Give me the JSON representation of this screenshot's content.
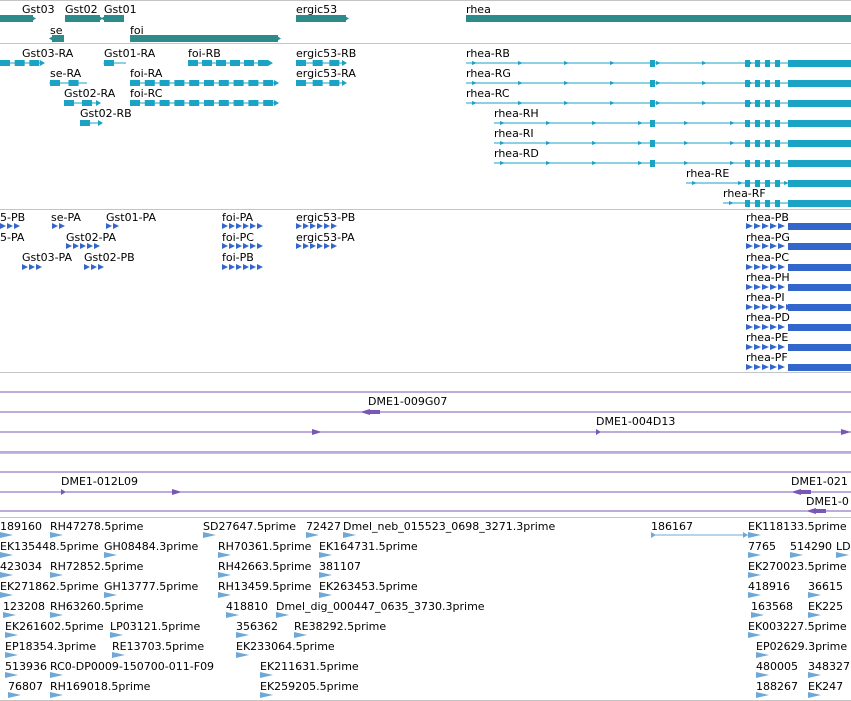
{
  "colors": {
    "gene": "#2e8b8b",
    "transcript": "#1aa3c4",
    "protein": "#3366cc",
    "clone": "#7b57b5",
    "est": "#6fa8d6",
    "separator": "#c4c4c4"
  },
  "tracks": [
    {
      "id": "gene-track",
      "features": [
        {
          "label": "Gst03",
          "kind": "gene",
          "strand": "+"
        },
        {
          "label": "Gst02",
          "kind": "gene",
          "strand": "+"
        },
        {
          "label": "Gst01",
          "kind": "gene",
          "strand": "-"
        },
        {
          "label": "se",
          "kind": "gene",
          "strand": "-"
        },
        {
          "label": "foi",
          "kind": "gene",
          "strand": "+"
        },
        {
          "label": "ergic53",
          "kind": "gene",
          "strand": "+"
        },
        {
          "label": "rhea",
          "kind": "gene",
          "strand": "+"
        }
      ]
    },
    {
      "id": "transcript-track",
      "features": [
        {
          "label": "Gst03-RA",
          "kind": "transcript",
          "strand": "+"
        },
        {
          "label": "Gst01-RA",
          "kind": "transcript",
          "strand": "-"
        },
        {
          "label": "foi-RB",
          "kind": "transcript",
          "strand": "+"
        },
        {
          "label": "ergic53-RB",
          "kind": "transcript",
          "strand": "+"
        },
        {
          "label": "rhea-RB",
          "kind": "transcript",
          "strand": "+"
        },
        {
          "label": "se-RA",
          "kind": "transcript",
          "strand": "-"
        },
        {
          "label": "foi-RA",
          "kind": "transcript",
          "strand": "+"
        },
        {
          "label": "ergic53-RA",
          "kind": "transcript",
          "strand": "+"
        },
        {
          "label": "rhea-RG",
          "kind": "transcript",
          "strand": "+"
        },
        {
          "label": "Gst02-RA",
          "kind": "transcript",
          "strand": "+"
        },
        {
          "label": "foi-RC",
          "kind": "transcript",
          "strand": "+"
        },
        {
          "label": "rhea-RC",
          "kind": "transcript",
          "strand": "+"
        },
        {
          "label": "Gst02-RB",
          "kind": "transcript",
          "strand": "+"
        },
        {
          "label": "rhea-RH",
          "kind": "transcript",
          "strand": "+"
        },
        {
          "label": "rhea-RI",
          "kind": "transcript",
          "strand": "+"
        },
        {
          "label": "rhea-RD",
          "kind": "transcript",
          "strand": "+"
        },
        {
          "label": "rhea-RE",
          "kind": "transcript",
          "strand": "+"
        },
        {
          "label": "rhea-RF",
          "kind": "transcript",
          "strand": "+"
        }
      ]
    },
    {
      "id": "protein-track",
      "features": [
        {
          "label": "5-PB",
          "kind": "protein",
          "strand": "+"
        },
        {
          "label": "se-PA",
          "kind": "protein",
          "strand": "-"
        },
        {
          "label": "Gst01-PA",
          "kind": "protein",
          "strand": "-"
        },
        {
          "label": "foi-PA",
          "kind": "protein",
          "strand": "+"
        },
        {
          "label": "ergic53-PB",
          "kind": "protein",
          "strand": "+"
        },
        {
          "label": "rhea-PB",
          "kind": "protein",
          "strand": "+"
        },
        {
          "label": "5-PA",
          "kind": "protein",
          "strand": "+"
        },
        {
          "label": "Gst02-PA",
          "kind": "protein",
          "strand": "+"
        },
        {
          "label": "foi-PC",
          "kind": "protein",
          "strand": "+"
        },
        {
          "label": "ergic53-PA",
          "kind": "protein",
          "strand": "+"
        },
        {
          "label": "rhea-PG",
          "kind": "protein",
          "strand": "+"
        },
        {
          "label": "Gst03-PA",
          "kind": "protein",
          "strand": "+"
        },
        {
          "label": "Gst02-PB",
          "kind": "protein",
          "strand": "+"
        },
        {
          "label": "foi-PB",
          "kind": "protein",
          "strand": "+"
        },
        {
          "label": "rhea-PC",
          "kind": "protein",
          "strand": "+"
        },
        {
          "label": "rhea-PH",
          "kind": "protein",
          "strand": "+"
        },
        {
          "label": "rhea-PI",
          "kind": "protein",
          "strand": "+"
        },
        {
          "label": "rhea-PD",
          "kind": "protein",
          "strand": "+"
        },
        {
          "label": "rhea-PE",
          "kind": "protein",
          "strand": "+"
        },
        {
          "label": "rhea-PF",
          "kind": "protein",
          "strand": "+"
        }
      ]
    },
    {
      "id": "clone-track-1",
      "features": [
        {
          "label": "DME1-009G07",
          "kind": "clone",
          "strand": "-"
        },
        {
          "label": "DME1-004D13",
          "kind": "clone",
          "strand": "+"
        }
      ]
    },
    {
      "id": "clone-track-2",
      "features": [
        {
          "label": "DME1-012L09",
          "kind": "clone",
          "strand": "+"
        },
        {
          "label": "DME1-021",
          "kind": "clone",
          "strand": "-"
        },
        {
          "label": "DME1-0",
          "kind": "clone",
          "strand": "-"
        }
      ]
    },
    {
      "id": "est-track",
      "features": [
        {
          "label": "189160",
          "kind": "est"
        },
        {
          "label": "RH47278.5prime",
          "kind": "est"
        },
        {
          "label": "SD27647.5prime",
          "kind": "est"
        },
        {
          "label": "72427",
          "kind": "est"
        },
        {
          "label": "Dmel_neb_015523_0698_3271.3prime",
          "kind": "est"
        },
        {
          "label": "186167",
          "kind": "est"
        },
        {
          "label": "EK118133.5prime",
          "kind": "est"
        },
        {
          "label": "EK135448.5prime",
          "kind": "est"
        },
        {
          "label": "GH08484.3prime",
          "kind": "est"
        },
        {
          "label": "RH70361.5prime",
          "kind": "est"
        },
        {
          "label": "EK164731.5prime",
          "kind": "est"
        },
        {
          "label": "7765",
          "kind": "est"
        },
        {
          "label": "514290",
          "kind": "est"
        },
        {
          "label": "LD",
          "kind": "est"
        },
        {
          "label": "423034",
          "kind": "est"
        },
        {
          "label": "RH72852.5prime",
          "kind": "est"
        },
        {
          "label": "RH42663.5prime",
          "kind": "est"
        },
        {
          "label": "381107",
          "kind": "est"
        },
        {
          "label": "EK270023.5prime",
          "kind": "est"
        },
        {
          "label": "EK271862.5prime",
          "kind": "est"
        },
        {
          "label": "GH13777.5prime",
          "kind": "est"
        },
        {
          "label": "RH13459.5prime",
          "kind": "est"
        },
        {
          "label": "EK263453.5prime",
          "kind": "est"
        },
        {
          "label": "418916",
          "kind": "est"
        },
        {
          "label": "36615",
          "kind": "est"
        },
        {
          "label": "123208",
          "kind": "est"
        },
        {
          "label": "RH63260.5prime",
          "kind": "est"
        },
        {
          "label": "418810",
          "kind": "est"
        },
        {
          "label": "Dmel_dig_000447_0635_3730.3prime",
          "kind": "est"
        },
        {
          "label": "163568",
          "kind": "est"
        },
        {
          "label": "EK225",
          "kind": "est"
        },
        {
          "label": "EK261602.5prime",
          "kind": "est"
        },
        {
          "label": "LP03121.5prime",
          "kind": "est"
        },
        {
          "label": "356362",
          "kind": "est"
        },
        {
          "label": "RE38292.5prime",
          "kind": "est"
        },
        {
          "label": "EK003227.5prime",
          "kind": "est"
        },
        {
          "label": "EP18354.3prime",
          "kind": "est"
        },
        {
          "label": "RE13703.5prime",
          "kind": "est"
        },
        {
          "label": "EK233064.5prime",
          "kind": "est"
        },
        {
          "label": "EP02629.3prime",
          "kind": "est"
        },
        {
          "label": "513936",
          "kind": "est"
        },
        {
          "label": "RC0-DP0009-150700-011-F09",
          "kind": "est"
        },
        {
          "label": "EK211631.5prime",
          "kind": "est"
        },
        {
          "label": "480005",
          "kind": "est"
        },
        {
          "label": "348327",
          "kind": "est"
        },
        {
          "label": "76807",
          "kind": "est"
        },
        {
          "label": "RH169018.5prime",
          "kind": "est"
        },
        {
          "label": "EK259205.5prime",
          "kind": "est"
        },
        {
          "label": "188267",
          "kind": "est"
        },
        {
          "label": "EK247",
          "kind": "est"
        }
      ]
    }
  ]
}
